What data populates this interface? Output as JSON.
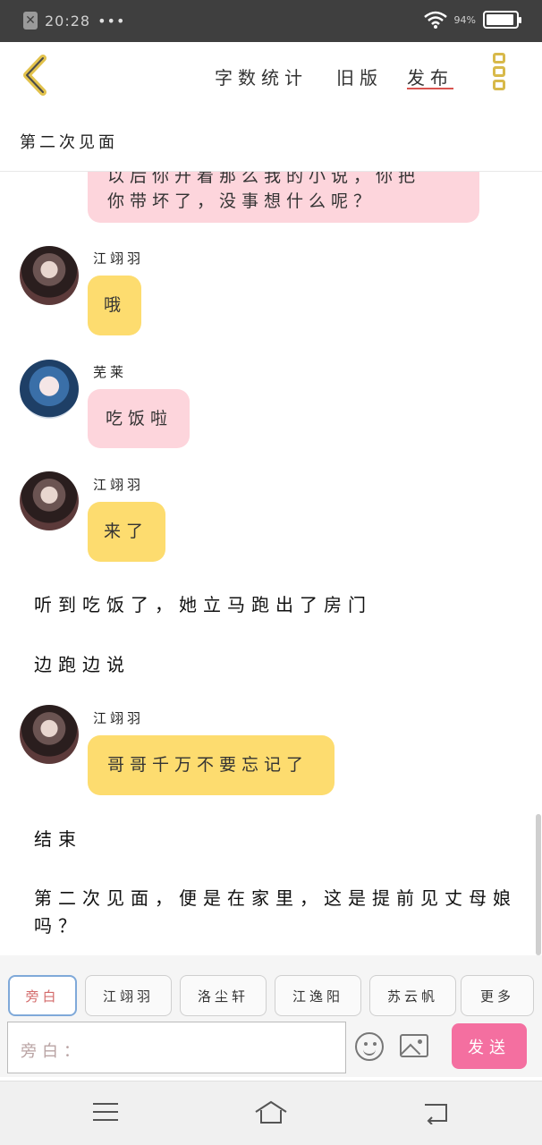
{
  "status_bar": {
    "time": "20:28",
    "dots": "•••",
    "battery_text": "94%",
    "battery_level": 0.94
  },
  "header": {
    "word_count": "字数统计",
    "old_version": "旧版",
    "publish": "发布",
    "title": "第二次见面"
  },
  "chat": {
    "messages": [
      {
        "type": "bubble",
        "speaker": "芜莱",
        "text": "以后你开着那么我的小说，你把你带坏了，没事想什么呢？",
        "color": "pink",
        "partial": true
      },
      {
        "type": "bubble",
        "speaker": "江翊羽",
        "text": "哦",
        "color": "yellow"
      },
      {
        "type": "bubble",
        "speaker": "芜莱",
        "text": "吃饭啦",
        "color": "pink"
      },
      {
        "type": "bubble",
        "speaker": "江翊羽",
        "text": "来了",
        "color": "yellow"
      },
      {
        "type": "narration",
        "text": "听到吃饭了，她立马跑出了房门"
      },
      {
        "type": "narration",
        "text": "边跑边说"
      },
      {
        "type": "bubble",
        "speaker": "江翊羽",
        "text": "哥哥千万不要忘记了",
        "color": "yellow"
      },
      {
        "type": "narration",
        "text": "结束"
      },
      {
        "type": "narration",
        "text": "第二次见面，便是在家里，这是提前见丈母娘吗？"
      }
    ],
    "partial_line_1": "以后你开着那么我的小说，你把",
    "partial_line_2": "你带坏了，没事想什么呢？",
    "narration_last_line_1": "第二次见面，便是在家里，这是提前见丈母娘",
    "narration_last_line_2": "吗？"
  },
  "roles": [
    "旁白",
    "江翊羽",
    "洛尘轩",
    "江逸阳",
    "苏云帆",
    "更多"
  ],
  "input": {
    "placeholder": "旁白："
  },
  "send_label": "发送",
  "colors": {
    "pink_bubble": "#fdd5dc",
    "yellow_bubble": "#fddc6f",
    "send_button": "#f46fa0",
    "accent_icon": "#d8b94a"
  }
}
